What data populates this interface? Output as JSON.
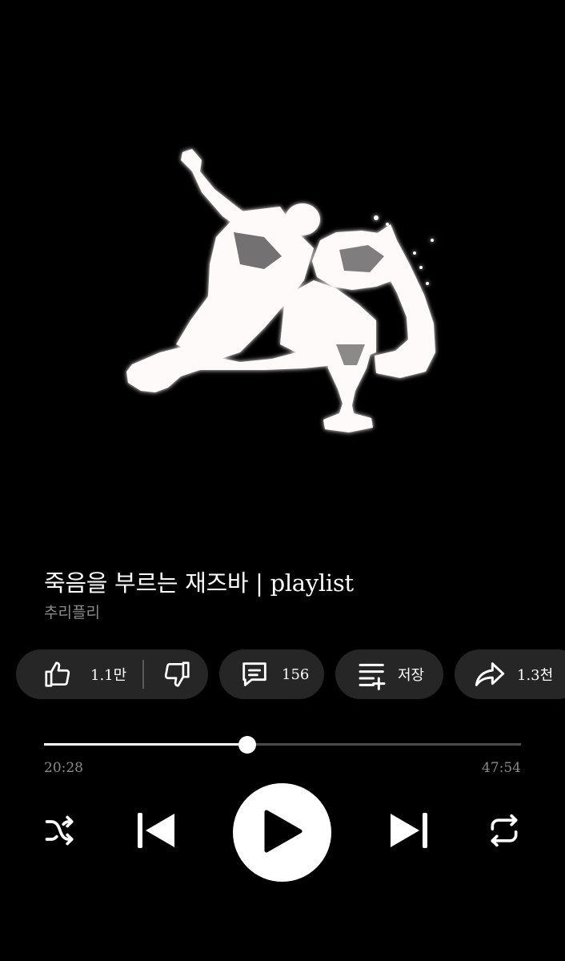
{
  "video": {
    "title": "죽음을 부르는 재즈바 | playlist",
    "channel": "추리플리"
  },
  "actions": {
    "like_count": "1.1만",
    "comment_count": "156",
    "save_label": "저장",
    "share_count": "1.3천"
  },
  "player": {
    "current_time": "20:28",
    "total_time": "47:54",
    "progress_fraction": 0.427
  },
  "icons": {
    "like": "thumbs-up-icon",
    "dislike": "thumbs-down-icon",
    "comment": "comment-icon",
    "save": "playlist-add-icon",
    "share": "share-icon",
    "shuffle": "shuffle-icon",
    "previous": "skip-previous-icon",
    "play": "play-icon",
    "next": "skip-next-icon",
    "repeat": "repeat-icon"
  },
  "colors": {
    "background": "#000000",
    "pill": "#262626",
    "secondary_text": "#8a8a8a",
    "track": "#4a4a4a"
  }
}
